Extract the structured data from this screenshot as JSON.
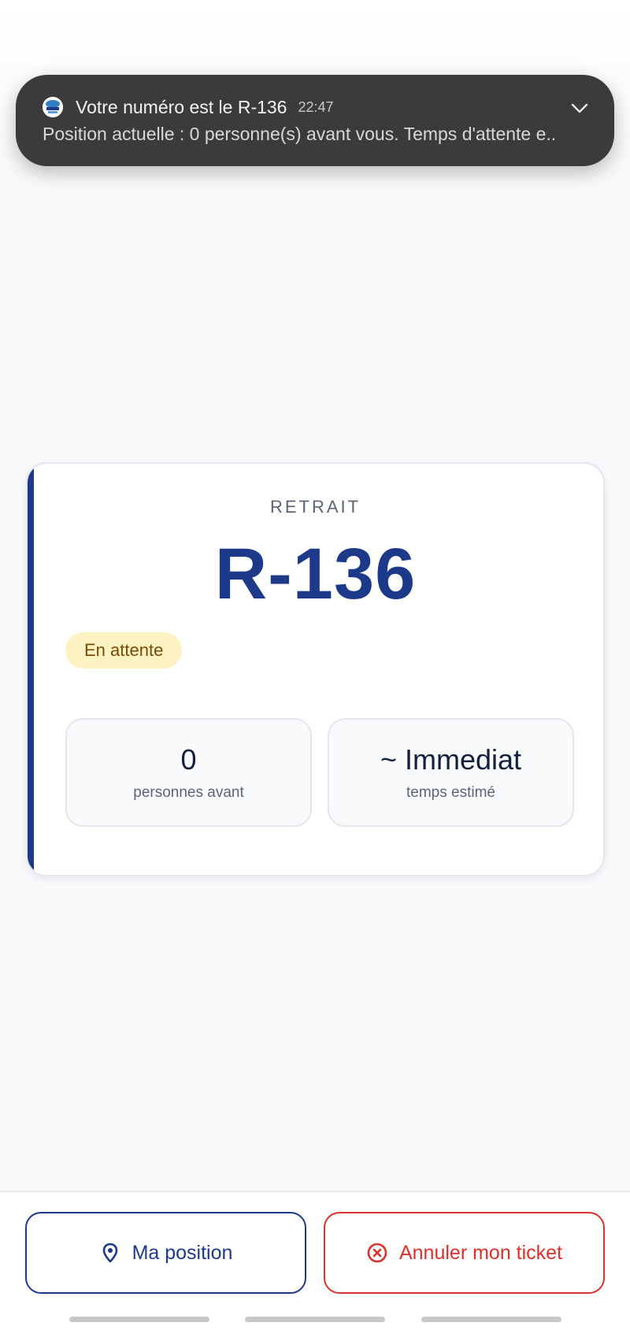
{
  "notification": {
    "title": "Votre numéro est le R-136",
    "time": "22:47",
    "body": "Position actuelle : 0 personne(s) avant vous. Temps d'attente e..",
    "app_icon": "app-logo-icon",
    "expand_icon": "chevron-down-icon"
  },
  "ticket": {
    "service": "RETRAIT",
    "number": "R-136",
    "status": "En attente",
    "stats": [
      {
        "value": "0",
        "label": "personnes avant"
      },
      {
        "value": "~ Immediat",
        "label": "temps estimé"
      }
    ]
  },
  "actions": {
    "position_label": "Ma position",
    "position_icon": "map-pin-icon",
    "cancel_label": "Annuler mon ticket",
    "cancel_icon": "circle-x-icon"
  },
  "colors": {
    "primary": "#1d3a8a",
    "danger": "#d9312b",
    "badge_bg": "#fdf3c2",
    "badge_text": "#7a4a06",
    "notification_bg": "#3b3b3b"
  }
}
